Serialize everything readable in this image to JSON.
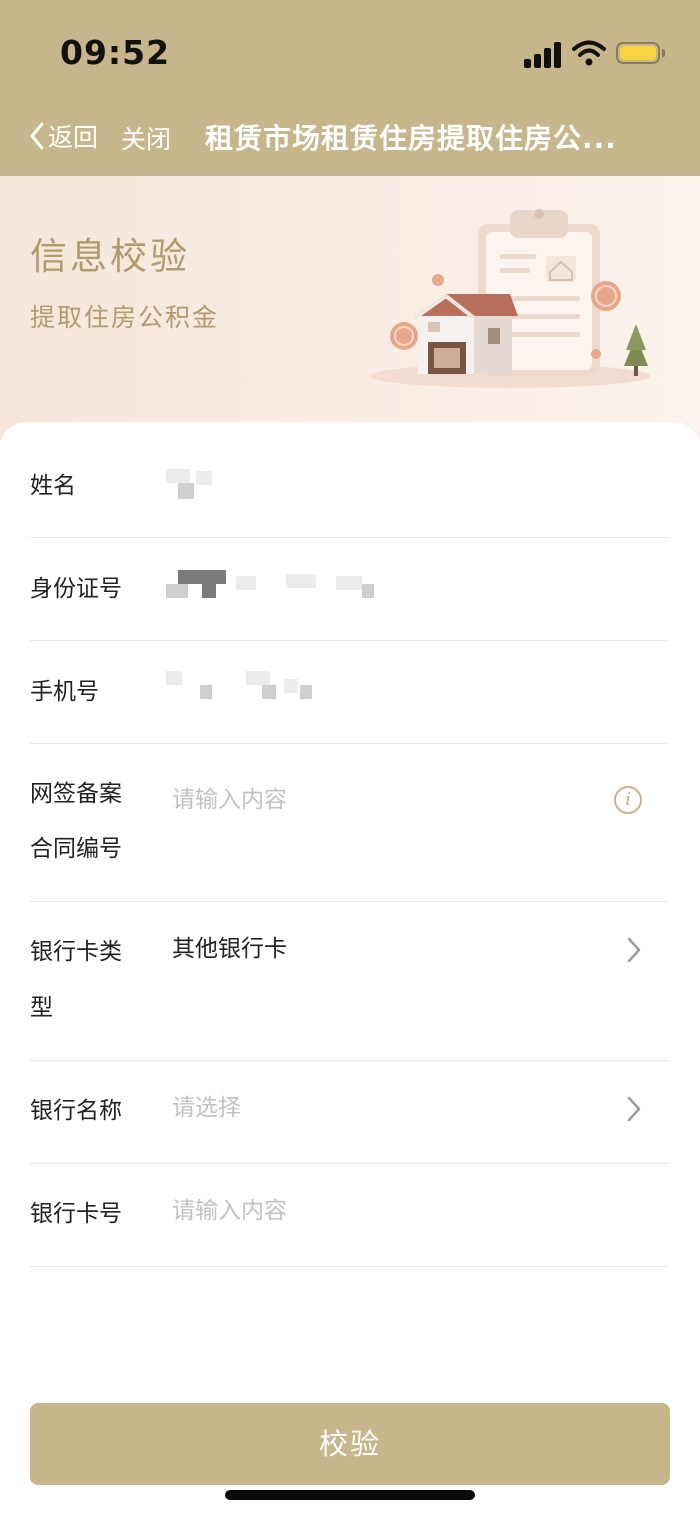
{
  "status_bar": {
    "time": "09:52"
  },
  "nav": {
    "back_label": "返回",
    "close_label": "关闭",
    "title": "租赁市场租赁住房提取住房公..."
  },
  "banner": {
    "title": "信息校验",
    "subtitle": "提取住房公积金"
  },
  "form": {
    "name_label": "姓名",
    "id_label": "身份证号",
    "phone_label": "手机号",
    "contract_label_line1": "网签备案",
    "contract_label_line2": "合同编号",
    "contract_placeholder": "请输入内容",
    "card_type_label_line1": "银行卡类",
    "card_type_label_line2": "型",
    "card_type_value": "其他银行卡",
    "bank_name_label": "银行名称",
    "bank_name_placeholder": "请选择",
    "card_number_label": "银行卡号",
    "card_number_placeholder": "请输入内容"
  },
  "submit_label": "校验",
  "colors": {
    "brand": "#c7b68b",
    "banner_text": "#b29a6d",
    "placeholder": "#c2c2c2"
  }
}
